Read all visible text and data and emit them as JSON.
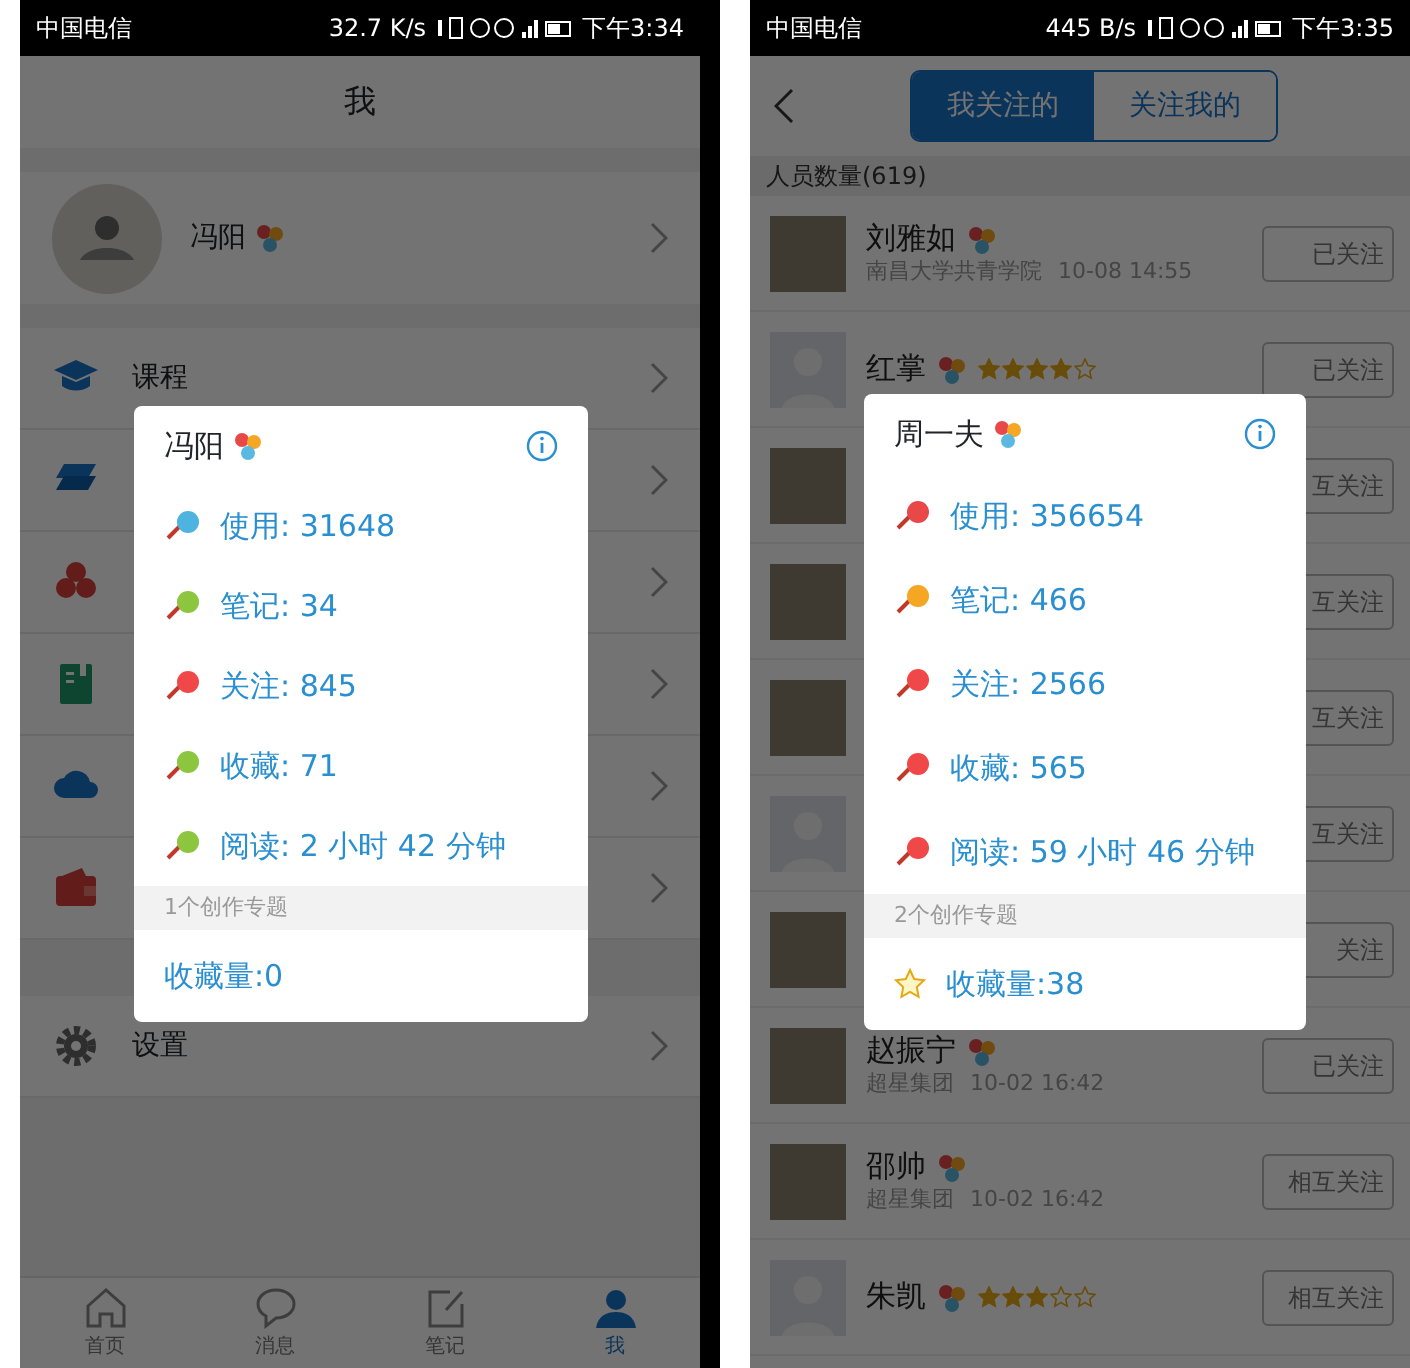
{
  "screens": [
    {
      "kind": "profile",
      "status_bar": {
        "carrier": "中国电信",
        "speed": "32.7 K/s",
        "time": "下午3:34"
      },
      "title": "我",
      "profile": {
        "name": "冯阳"
      },
      "menu_groups": [
        [
          {
            "kind": "course",
            "label": "课程"
          },
          {
            "kind": "layers"
          },
          {
            "kind": "cluster"
          },
          {
            "kind": "notebook"
          },
          {
            "kind": "cloud"
          },
          {
            "kind": "wallet"
          }
        ],
        [
          {
            "kind": "settings",
            "label": "设置"
          }
        ]
      ],
      "tab_bar": [
        {
          "kind": "home",
          "label": "首页",
          "selected": false
        },
        {
          "kind": "chat",
          "label": "消息",
          "selected": false
        },
        {
          "kind": "note",
          "label": "笔记",
          "selected": false
        },
        {
          "kind": "person",
          "label": "我",
          "selected": true
        }
      ],
      "popup": {
        "name": "冯阳",
        "stats": [
          {
            "label": "使用: 31648",
            "color": "#4fb3e0"
          },
          {
            "label": "笔记: 34",
            "color": "#8cc63f"
          },
          {
            "label": "关注: 845",
            "color": "#f04848"
          },
          {
            "label": "收藏: 71",
            "color": "#8cc63f"
          },
          {
            "label": "阅读: 2 小时 42 分钟",
            "color": "#8cc63f"
          }
        ],
        "section": "1个创作专题",
        "favorites": "收藏量:0",
        "starred": false
      }
    },
    {
      "kind": "following",
      "status_bar": {
        "carrier": "中国电信",
        "speed": "445 B/s",
        "time": "下午3:35"
      },
      "segments": [
        {
          "label": "我关注的",
          "selected": true
        },
        {
          "label": "关注我的",
          "selected": false
        }
      ],
      "count": "人员数量(619)",
      "people": [
        {
          "kind": "photo",
          "name": "刘雅如",
          "subtitle": "南昌大学共青学院",
          "time": "10-08 14:55",
          "button": "已关注"
        },
        {
          "kind": "default",
          "name": "红掌",
          "stars": 4,
          "button": "已关注"
        },
        {
          "kind": "photo",
          "button": "互关注"
        },
        {
          "kind": "photo",
          "button": "互关注"
        },
        {
          "kind": "photo",
          "button": "互关注"
        },
        {
          "kind": "default",
          "button": "互关注"
        },
        {
          "kind": "photo",
          "button": "关注"
        },
        {
          "kind": "photo",
          "name": "赵振宁",
          "subtitle": "超星集团",
          "time": "10-02 16:42",
          "button": "已关注"
        },
        {
          "kind": "photo",
          "name": "邵帅",
          "subtitle": "超星集团",
          "time": "10-02 16:42",
          "button": "相互关注"
        },
        {
          "kind": "default",
          "name": "朱凯",
          "stars": 3,
          "button": "相互关注"
        }
      ],
      "popup": {
        "name": "周一夫",
        "stats": [
          {
            "label": "使用: 356654",
            "color": "#e84848"
          },
          {
            "label": "笔记: 466",
            "color": "#f5a623"
          },
          {
            "label": "关注: 2566",
            "color": "#f04848"
          },
          {
            "label": "收藏: 565",
            "color": "#f04848"
          },
          {
            "label": "阅读: 59 小时 46 分钟",
            "color": "#f04848"
          }
        ],
        "section": "2个创作专题",
        "favorites": "收藏量:38",
        "starred": true
      }
    }
  ]
}
